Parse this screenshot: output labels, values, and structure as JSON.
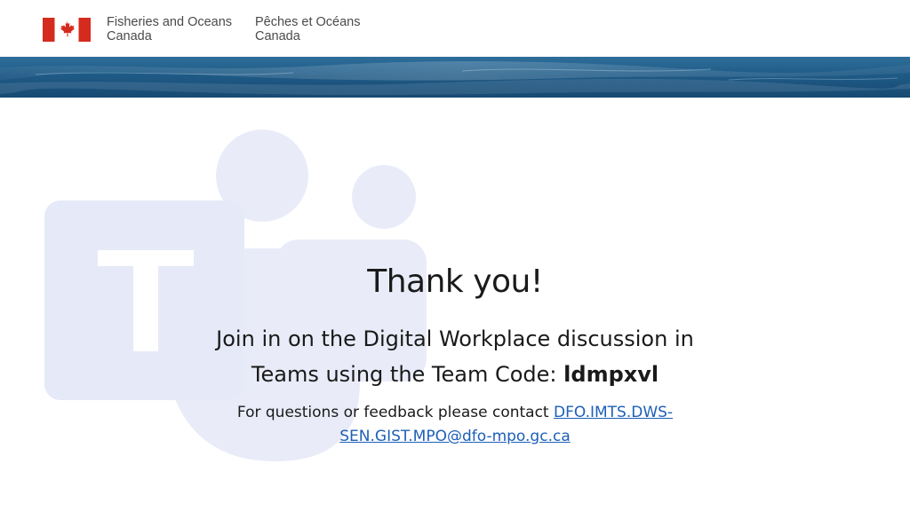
{
  "header": {
    "dept_en_line1": "Fisheries and Oceans",
    "dept_en_line2": "Canada",
    "dept_fr_line1": "Pêches et Océans",
    "dept_fr_line2": "Canada"
  },
  "main": {
    "title": "Thank you!",
    "join_line1": "Join in on the Digital Workplace discussion in",
    "join_line2_prefix": "Teams using the Team Code: ",
    "team_code": "ldmpxvl",
    "contact_prefix": "For questions or feedback please contact ",
    "contact_email_part1": "DFO.IMTS.DWS-",
    "contact_email_part2": "SEN.GIST.MPO@dfo-mpo.gc.ca"
  },
  "colors": {
    "flag_red": "#d52b1e",
    "link_blue": "#1d5fb8",
    "watermark": "#e9ecf8"
  },
  "icons": {
    "flag": "canada-flag-icon",
    "watermark": "microsoft-teams-logo"
  }
}
